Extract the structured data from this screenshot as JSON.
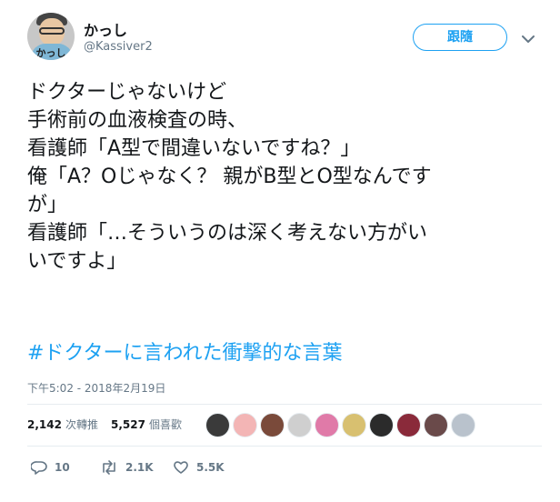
{
  "user": {
    "display_name": "かっし",
    "username": "@Kassiver2",
    "avatar_text": "かっし"
  },
  "follow_button_label": "跟隨",
  "tweet": {
    "lines": [
      "ドクターじゃないけど",
      "",
      "手術前の血液検査の時、",
      "看護師「A型で間違いないですね？」",
      "俺「A？Oじゃなく？ 親がB型とO型なんです",
      "が」",
      "看護師「…そういうのは深く考えない方がい",
      "いですよ」"
    ],
    "hashtag": "#ドクターに言われた衝撃的な言葉",
    "timestamp": "下午5:02 - 2018年2月19日"
  },
  "stats": {
    "retweets_count": "2,142",
    "retweets_label": "次轉推",
    "likes_count": "5,527",
    "likes_label": "個喜歡"
  },
  "likers": [
    {
      "name": "liker-avatar-1",
      "color": "#3a3a3a"
    },
    {
      "name": "liker-avatar-2",
      "color": "#f3b5b5"
    },
    {
      "name": "liker-avatar-3",
      "color": "#7a4a3a"
    },
    {
      "name": "liker-avatar-4",
      "color": "#cfcfcf"
    },
    {
      "name": "liker-avatar-5",
      "color": "#e07aa8"
    },
    {
      "name": "liker-avatar-6",
      "color": "#d8c070"
    },
    {
      "name": "liker-avatar-7",
      "color": "#2b2b2b"
    },
    {
      "name": "liker-avatar-8",
      "color": "#8a2a3a"
    },
    {
      "name": "liker-avatar-9",
      "color": "#6a4a4a"
    },
    {
      "name": "liker-avatar-10",
      "color": "#b9c2cc"
    }
  ],
  "actions": {
    "reply_count": "10",
    "retweet_count": "2.1K",
    "like_count": "5.5K"
  },
  "colors": {
    "accent": "#1da1f2",
    "muted": "#657786",
    "text": "#14171a",
    "divider": "#e6ecf0"
  }
}
